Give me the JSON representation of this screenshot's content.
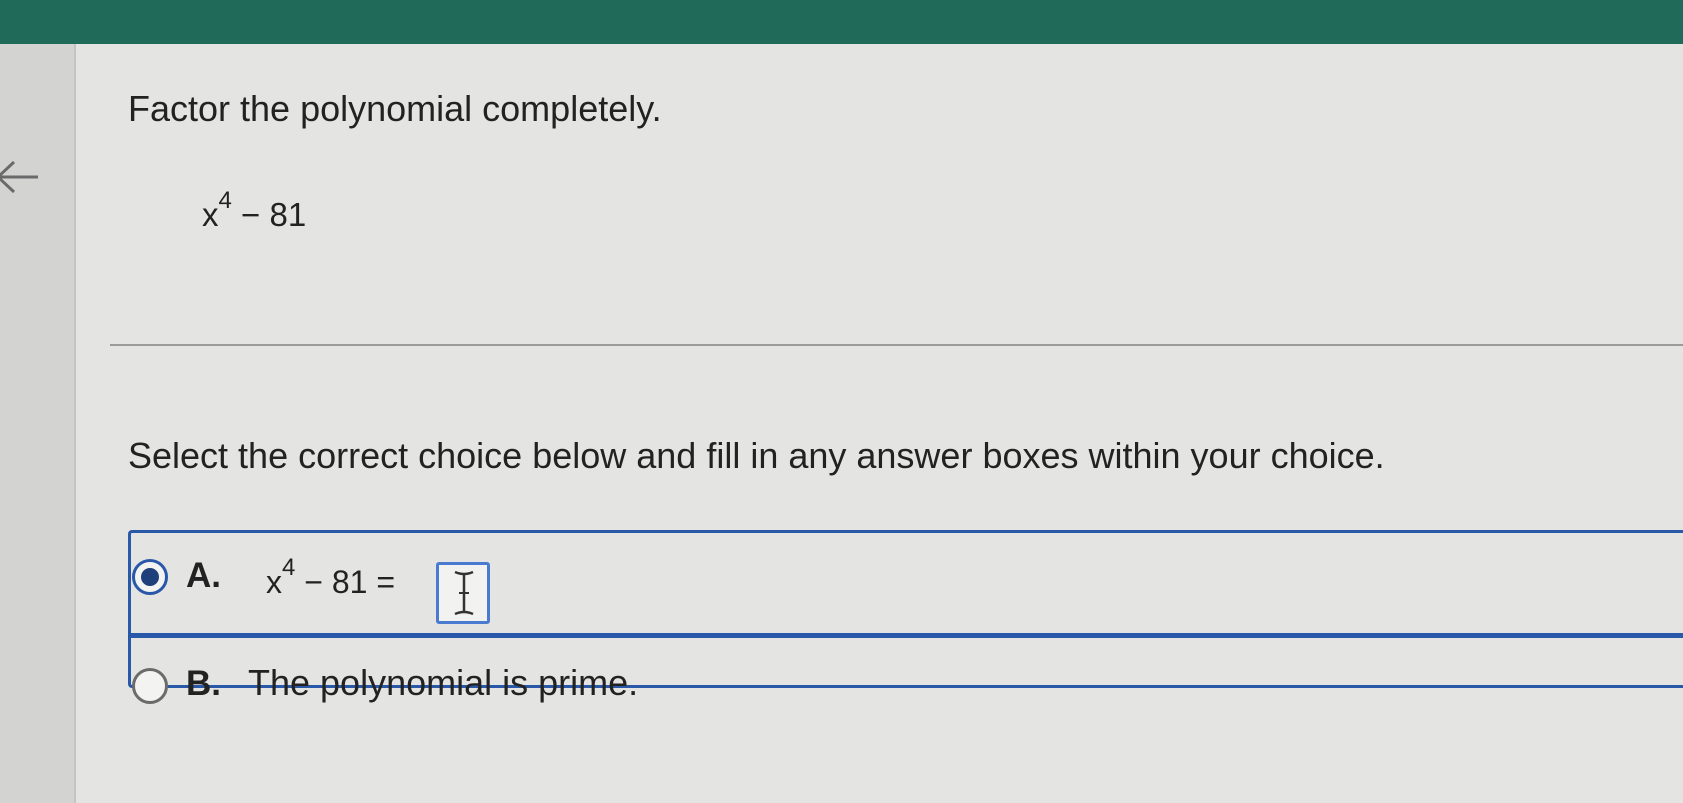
{
  "question": {
    "title": "Factor the polynomial completely.",
    "polynomial": {
      "base": "x",
      "exponent": "4",
      "rest": " − 81"
    }
  },
  "instruction": "Select the correct choice below and fill in any answer boxes within your choice.",
  "choices": [
    {
      "letter": "A.",
      "selected": true,
      "expr": {
        "base": "x",
        "exponent": "4",
        "rest": " − 81 ="
      },
      "answer_value": ""
    },
    {
      "letter": "B.",
      "selected": false,
      "text": "The polynomial is prime."
    }
  ],
  "icons": {
    "back": "back-arrow-icon",
    "cursor": "text-cursor-icon"
  },
  "colors": {
    "header": "#1f6a58",
    "accent": "#2a58a8"
  }
}
